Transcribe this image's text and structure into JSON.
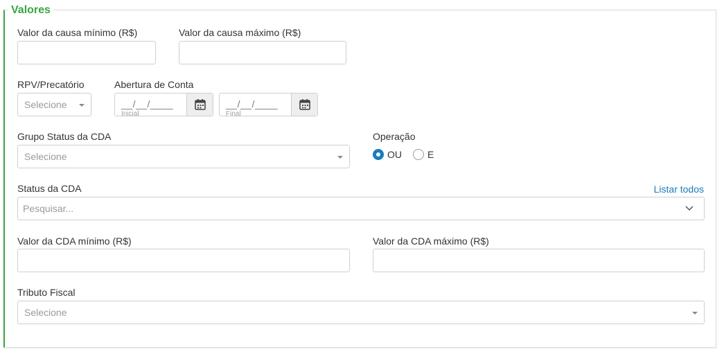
{
  "section": {
    "title": "Valores"
  },
  "valor_causa": {
    "min_label": "Valor da causa mínimo (R$)",
    "max_label": "Valor da causa máximo (R$)",
    "min_value": "",
    "max_value": ""
  },
  "rpv": {
    "label": "RPV/Precatório",
    "placeholder": "Selecione"
  },
  "abertura": {
    "label": "Abertura de Conta",
    "inicial": {
      "mask": "__/__/____",
      "hint": "Inicial"
    },
    "final": {
      "mask": "__/__/____",
      "hint": "Final"
    }
  },
  "grupo_status": {
    "label": "Grupo Status da CDA",
    "placeholder": "Selecione"
  },
  "operacao": {
    "label": "Operação",
    "options": [
      {
        "label": "OU",
        "selected": true
      },
      {
        "label": "E",
        "selected": false
      }
    ]
  },
  "status_cda": {
    "label": "Status da CDA",
    "link": "Listar todos",
    "placeholder": "Pesquisar..."
  },
  "valor_cda": {
    "min_label": "Valor da CDA mínimo (R$)",
    "max_label": "Valor da CDA máximo (R$)",
    "min_value": "",
    "max_value": ""
  },
  "tributo": {
    "label": "Tributo Fiscal",
    "placeholder": "Selecione"
  },
  "colors": {
    "accent": "#3aa53f",
    "link": "#1a7bbf",
    "border": "#cfcfcf"
  },
  "icons": {
    "calendar": "calendar-icon",
    "chevron": "chevron-down-icon",
    "caret": "caret-down-icon"
  }
}
